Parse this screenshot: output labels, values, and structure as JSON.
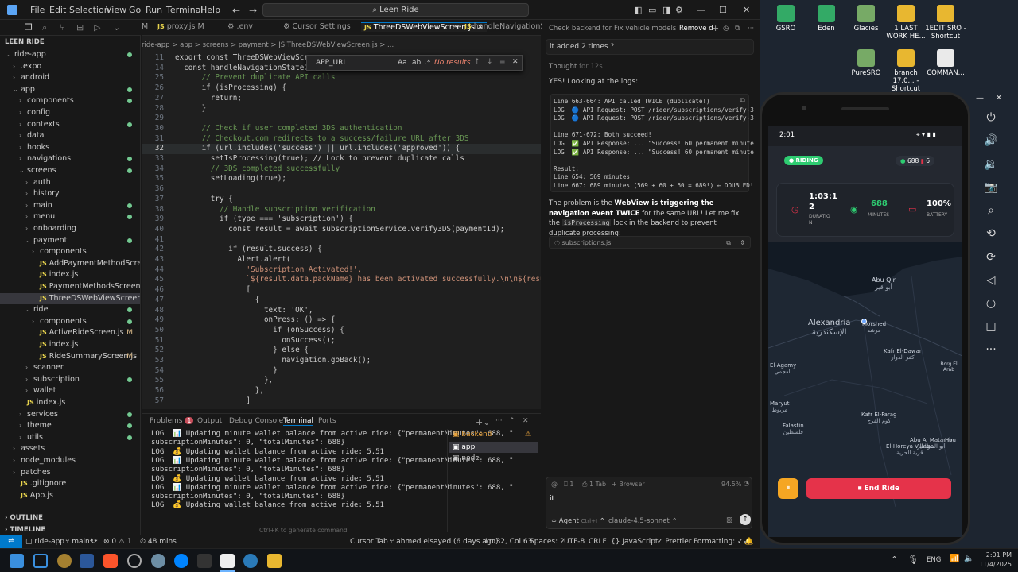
{
  "titlebar": {
    "menus": [
      "File",
      "Edit",
      "Selection",
      "View",
      "Go",
      "Run",
      "Terminal",
      "Help"
    ],
    "search": "Leen Ride"
  },
  "tabs": [
    "proxy.js M",
    ".env",
    "Cursor Settings",
    "ThreeDSWebViewScreen.js",
    "handleNavigationSt"
  ],
  "explorer": {
    "title": "LEEN RIDE",
    "items": [
      {
        "label": "ride-app",
        "depth": 1,
        "open": true,
        "dot": true
      },
      {
        "label": ".expo",
        "depth": 2
      },
      {
        "label": "android",
        "depth": 2
      },
      {
        "label": "app",
        "depth": 2,
        "open": true,
        "dot": true
      },
      {
        "label": "components",
        "depth": 3,
        "dot": true
      },
      {
        "label": "config",
        "depth": 3
      },
      {
        "label": "contexts",
        "depth": 3,
        "dot": true
      },
      {
        "label": "data",
        "depth": 3
      },
      {
        "label": "hooks",
        "depth": 3
      },
      {
        "label": "navigations",
        "depth": 3,
        "dot": true
      },
      {
        "label": "screens",
        "depth": 3,
        "open": true,
        "dot": true
      },
      {
        "label": "auth",
        "depth": 4
      },
      {
        "label": "history",
        "depth": 4
      },
      {
        "label": "main",
        "depth": 4,
        "dot": true
      },
      {
        "label": "menu",
        "depth": 4,
        "dot": true
      },
      {
        "label": "onboarding",
        "depth": 4
      },
      {
        "label": "payment",
        "depth": 4,
        "open": true,
        "dot": true
      },
      {
        "label": "components",
        "depth": 5
      },
      {
        "label": "AddPaymentMethodScreen.js",
        "depth": 5,
        "file": true
      },
      {
        "label": "index.js",
        "depth": 5,
        "file": true
      },
      {
        "label": "PaymentMethodsScreen.js",
        "depth": 5,
        "file": true
      },
      {
        "label": "ThreeDSWebViewScreen.js",
        "depth": 5,
        "file": true,
        "selected": true
      },
      {
        "label": "ride",
        "depth": 4,
        "open": true,
        "dot": true
      },
      {
        "label": "components",
        "depth": 5,
        "dot": true
      },
      {
        "label": "ActiveRideScreen.js",
        "depth": 5,
        "file": true,
        "mark": "M"
      },
      {
        "label": "index.js",
        "depth": 5,
        "file": true
      },
      {
        "label": "RideSummaryScreen.js",
        "depth": 5,
        "file": true,
        "mark": "M"
      },
      {
        "label": "scanner",
        "depth": 4
      },
      {
        "label": "subscription",
        "depth": 4,
        "dot": true
      },
      {
        "label": "wallet",
        "depth": 4
      },
      {
        "label": "index.js",
        "depth": 3,
        "file": true
      },
      {
        "label": "services",
        "depth": 3,
        "dot": true
      },
      {
        "label": "theme",
        "depth": 3,
        "dot": true
      },
      {
        "label": "utils",
        "depth": 3,
        "dot": true
      },
      {
        "label": "assets",
        "depth": 2
      },
      {
        "label": "node_modules",
        "depth": 2
      },
      {
        "label": "patches",
        "depth": 2
      },
      {
        "label": ".gitignore",
        "depth": 2,
        "file": true
      },
      {
        "label": "App.js",
        "depth": 2,
        "file": true
      }
    ],
    "outline": "OUTLINE",
    "timeline": "TIMELINE"
  },
  "breadcrumb": "ride-app > app > screens > payment > JS ThreeDSWebViewScreen.js > ...",
  "find": {
    "label": "APP_URL",
    "result": "No results"
  },
  "code": [
    {
      "n": "11",
      "t": "export const ThreeDSWebViewScre"
    },
    {
      "n": "14",
      "t": "  const handleNavigationStateCh"
    },
    {
      "n": "25",
      "t": "      // Prevent duplicate API calls"
    },
    {
      "n": "26",
      "t": "      if (isProcessing) {"
    },
    {
      "n": "27",
      "t": "        return;"
    },
    {
      "n": "28",
      "t": "      }"
    },
    {
      "n": "29",
      "t": ""
    },
    {
      "n": "30",
      "t": "      // Check if user completed 3DS authentication"
    },
    {
      "n": "31",
      "t": "      // Checkout.com redirects to a success/failure URL after 3DS"
    },
    {
      "n": "32",
      "t": "      if (url.includes('success') || url.includes('approved')) {"
    },
    {
      "n": "33",
      "t": "        setIsProcessing(true); // Lock to prevent duplicate calls"
    },
    {
      "n": "34",
      "t": "        // 3DS completed successfully"
    },
    {
      "n": "35",
      "t": "        setLoading(true);"
    },
    {
      "n": "36",
      "t": ""
    },
    {
      "n": "37",
      "t": "        try {"
    },
    {
      "n": "38",
      "t": "          // Handle subscription verification"
    },
    {
      "n": "39",
      "t": "          if (type === 'subscription') {"
    },
    {
      "n": "40",
      "t": "            const result = await subscriptionService.verify3DS(paymentId);"
    },
    {
      "n": "41",
      "t": ""
    },
    {
      "n": "42",
      "t": "            if (result.success) {"
    },
    {
      "n": "43",
      "t": "              Alert.alert("
    },
    {
      "n": "44",
      "t": "                'Subscription Activated!',"
    },
    {
      "n": "45",
      "t": "                `${result.data.packName} has been activated successfully.\\n\\n${result.data."
    },
    {
      "n": "46",
      "t": "                ["
    },
    {
      "n": "47",
      "t": "                  {"
    },
    {
      "n": "48",
      "t": "                    text: 'OK',"
    },
    {
      "n": "49",
      "t": "                    onPress: () => {"
    },
    {
      "n": "50",
      "t": "                      if (onSuccess) {"
    },
    {
      "n": "51",
      "t": "                        onSuccess();"
    },
    {
      "n": "52",
      "t": "                      } else {"
    },
    {
      "n": "53",
      "t": "                        navigation.goBack();"
    },
    {
      "n": "54",
      "t": "                      }"
    },
    {
      "n": "55",
      "t": "                    },"
    },
    {
      "n": "56",
      "t": "                  },"
    },
    {
      "n": "57",
      "t": "                ]"
    }
  ],
  "panel": {
    "tabs": [
      "Problems",
      "Output",
      "Debug Console",
      "Terminal",
      "Ports"
    ],
    "problems_count": "1",
    "lines": [
      "LOG  📊 Updating minute wallet balance from active ride: {\"permanentMinutes\": 688, \"",
      "subscriptionMinutes\": 0, \"totalMinutes\": 688}",
      "LOG  💰 Updating wallet balance from active ride: 5.51",
      "LOG  📊 Updating minute wallet balance from active ride: {\"permanentMinutes\": 688, \"",
      "subscriptionMinutes\": 0, \"totalMinutes\": 688}",
      "LOG  💰 Updating wallet balance from active ride: 5.51",
      "LOG  📊 Updating minute wallet balance from active ride: {\"permanentMinutes\": 688, \"",
      "subscriptionMinutes\": 0, \"totalMinutes\": 688}",
      "LOG  💰 Updating wallet balance from active ride: 5.51"
    ],
    "terminals": [
      "backend",
      "app",
      "node"
    ],
    "hint": "Ctrl+K to generate command"
  },
  "status": {
    "branch": "main*",
    "errors": "0",
    "warnings": "1",
    "time": "48 mins",
    "cursortab": "Cursor Tab",
    "blame": "ahmed elsayed (6 days ago)",
    "pos": "Ln 32, Col 63",
    "spaces": "Spaces: 2",
    "enc": "UTF-8",
    "eol": "CRLF",
    "lang": "JavaScript",
    "prettier": "Prettier",
    "formatting": "Formatting: ✓✓",
    "project": "ride-app"
  },
  "chat": {
    "tabs": [
      "Check backend for",
      "Fix vehicle models",
      "Remove d"
    ],
    "question": "it added 2 times ?",
    "thought": "Thought",
    "thought_time": "for 12s",
    "intro": "YES! Looking at the logs:",
    "code": [
      "Line 663-664: API called TWICE (duplicate!)",
      "LOG  🔵 API Request: POST /rider/subscriptions/verify-3",
      "LOG  🔵 API Request: POST /rider/subscriptions/verify-3",
      "",
      "Line 671-672: Both succeed!",
      "LOG  ✅ API Response: ... \"Success! 60 permanent minute",
      "LOG  ✅ API Response: ... \"Success! 60 permanent minute",
      "",
      "Result:",
      "Line 654: 569 minutes",
      "Line 667: 689 minutes (569 + 60 + 60 = 689!) ← DOUBLED!"
    ],
    "para1": "The problem is the ",
    "para_bold": "WebView is triggering the navigation event TWICE",
    "para2": " for the same URL! Let me fix the ",
    "para_code": "isProcessing",
    "para3": " lock in the backend to prevent duplicate processing:",
    "file": "subscriptions.js",
    "input_meta": [
      "1",
      "1 Tab",
      "Browser"
    ],
    "usage": "94.5%",
    "typed": "it",
    "mode": "Agent",
    "mode_key": "Ctrl+I",
    "model": "claude-4.5-sonnet"
  },
  "desktop": {
    "icons": [
      {
        "label": "GSRO",
        "color": "#3a6"
      },
      {
        "label": "Eden",
        "color": "#3a6"
      },
      {
        "label": "Glacies",
        "color": "#7a6"
      },
      {
        "label": "1 LAST WORK HE...",
        "color": "#e8b730"
      },
      {
        "label": "1EDIT SRO - Shortcut",
        "color": "#e8b730"
      },
      {
        "label": "PureSRO",
        "color": "#7a6"
      },
      {
        "label": "branch 17.0... - Shortcut",
        "color": "#e8b730"
      },
      {
        "label": "COMMAN...",
        "color": "#eaeaea"
      }
    ]
  },
  "phone": {
    "time": "2:01",
    "badge": "RIDING",
    "mins_badge": "688",
    "fuel_badge": "6",
    "duration_val": "1:03:1 2",
    "duration_label": "DURATIO N",
    "minutes_val": "688",
    "minutes_label": "MINUTES",
    "battery_val": "100%",
    "battery_label": "BATTERY",
    "map_labels": [
      {
        "t": "Abu Qir",
        "s": "أبو قير"
      },
      {
        "t": "Alexandria",
        "s": "الإسكندرية"
      },
      {
        "t": "Morshed",
        "s": "مرشد"
      },
      {
        "t": "Kafr El-Dawar",
        "s": "كفر الدوار"
      },
      {
        "t": "El-Agamy",
        "s": "العجمي"
      },
      {
        "t": "Borg El Arab",
        "s": ""
      },
      {
        "t": "Maryut",
        "s": "مريوط"
      },
      {
        "t": "Kafr El-Farag",
        "s": "كوم الفرج"
      },
      {
        "t": "Falastin",
        "s": "فلسطين"
      },
      {
        "t": "Abu Al Matamir",
        "s": "أبو المطامير"
      },
      {
        "t": "El-Horeya Village",
        "s": "قرية الحرية"
      },
      {
        "t": "Hou",
        "s": ""
      }
    ],
    "end_ride": "End Ride"
  },
  "tray": {
    "lang": "ENG",
    "time": "2:01 PM",
    "date": "11/4/2025"
  },
  "colors": {
    "accent": "#007acc",
    "green": "#2ecc71",
    "red": "#e5334a",
    "orange": "#f5a623"
  }
}
